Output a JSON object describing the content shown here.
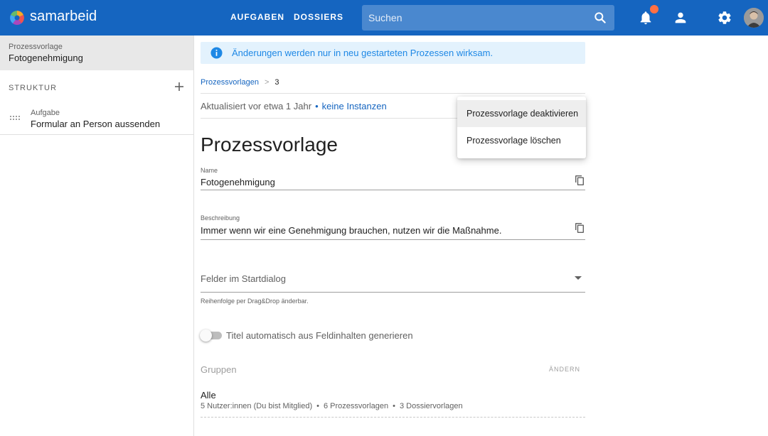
{
  "app": {
    "brand": "samarbeid"
  },
  "nav": {
    "aufgaben": "AUFGABEN",
    "dossiers": "DOSSIERS"
  },
  "search": {
    "placeholder": "Suchen"
  },
  "colors": {
    "topbar": "#1565c0",
    "badge": "#ff7043",
    "link": "#1565c0",
    "info_bg": "#e3f2fd",
    "info_text": "#1e88e5"
  },
  "sidebar": {
    "head_small": "Prozessvorlage",
    "head_big": "Fotogenehmigung",
    "section": "STRUKTUR",
    "items": [
      {
        "type": "Aufgabe",
        "label": "Formular an Person aussenden"
      }
    ]
  },
  "main": {
    "info": "Änderungen werden nur in neu gestarteten Prozessen wirksam.",
    "breadcrumb": {
      "link": "Prozessvorlagen",
      "sep": ">",
      "current": "3"
    },
    "meta": {
      "updated": "Aktualisiert vor etwa 1 Jahr",
      "dot": "•",
      "instances": "keine Instanzen"
    },
    "title": "Prozessvorlage",
    "name": {
      "label": "Name",
      "value": "Fotogenehmigung"
    },
    "description": {
      "label": "Beschreibung",
      "value": "Immer wenn wir eine Genehmigung brauchen, nutzen wir die Maßnahme."
    },
    "start_fields": {
      "label": "Felder im Startdialog",
      "hint": "Reihenfolge per Drag&Drop änderbar."
    },
    "toggle": {
      "label": "Titel automatisch aus Feldinhalten generieren",
      "checked": false
    },
    "groups": {
      "title": "Gruppen",
      "action": "ÄNDERN",
      "items": [
        {
          "name": "Alle",
          "members": "5 Nutzer:innen (Du bist Mitglied)",
          "processes": "6 Prozessvorlagen",
          "dossiers": "3 Dossiervorlagen",
          "sep": "•"
        }
      ]
    }
  },
  "menu": {
    "items": [
      "Prozessvorlage deaktivieren",
      "Prozessvorlage löschen"
    ]
  }
}
